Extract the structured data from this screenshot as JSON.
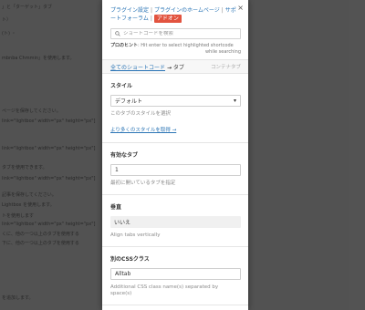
{
  "background": {
    "lines": [
      "」と「ターゲット」タブ",
      "ト）",
      "(ト) ・",
      "mbnba Chmmin」を使用します。",
      "",
      "ページを保存してください。",
      "link=\"lightbox\" width=\"px\" height=\"px\"]",
      "",
      "link=\"lightbox\" width=\"px\" height=\"px\"]",
      "",
      "タブを使用できます。",
      "link=\"lightbox\" width=\"px\" height=\"px\"]",
      "",
      "記事を保存してください。",
      "Lightbox を使用します。",
      "トを使用します",
      "link=\"lightbox\" width=\"px\" height=\"px\"]",
      "",
      "くに、他の一つ以上のタブを使用する",
      "下に、他の一つ以上のタブを使用する",
      "",
      "",
      "",
      "を追加します。"
    ]
  },
  "header": {
    "link_settings": "プラグイン設定",
    "link_homepage": "プラグインのホームページ",
    "link_forum": "サポートフォーラム",
    "addon_label": "アドオン",
    "separator": "|",
    "close": "×"
  },
  "search": {
    "placeholder": "ショートコードを検索",
    "hint_bold": "プロのヒント",
    "hint_text": ": Hit enter to select highlighted shortcode",
    "hint_text2": "while searching"
  },
  "breadcrumb": {
    "all": "全てのショートコード",
    "arrow": "→",
    "current": "タブ",
    "right": "コンテナタブ"
  },
  "style_section": {
    "label": "スタイル",
    "value": "デフォルト",
    "desc": "このタブのスタイルを選択",
    "more": "より多くのスタイルを取得 →"
  },
  "active_section": {
    "label": "有効なタブ",
    "value": "1",
    "desc": "最初に開いているタブを指定"
  },
  "vertical_section": {
    "label": "垂直",
    "value": "いいえ",
    "desc": "Align tabs vertically"
  },
  "css_section": {
    "label": "別のCSSクラス",
    "value": "Alltab",
    "desc": "Additional CSS class name(s) separated by space(s)"
  }
}
